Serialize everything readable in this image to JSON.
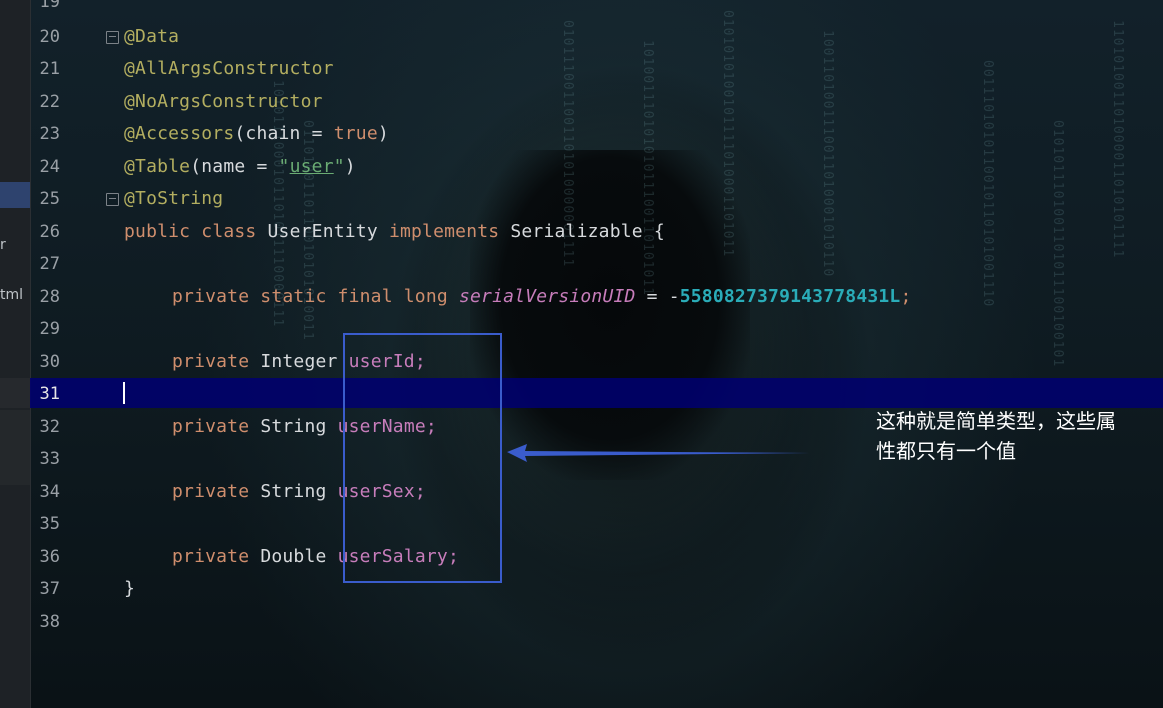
{
  "sidebar": {
    "fragments": [
      "r",
      "tml"
    ]
  },
  "gutter": {
    "lines": [
      "19",
      "20",
      "21",
      "22",
      "23",
      "24",
      "25",
      "26",
      "27",
      "28",
      "29",
      "30",
      "31",
      "32",
      "33",
      "34",
      "35",
      "36",
      "37",
      "38"
    ],
    "active_line": "31"
  },
  "code": {
    "line20": "@Data",
    "line21": "@AllArgsConstructor",
    "line22": "@NoArgsConstructor",
    "line23_ann": "@Accessors",
    "line23_args_a": "(chain = ",
    "line23_val": "true",
    "line23_args_b": ")",
    "line24_ann": "@Table",
    "line24_args_a": "(name = ",
    "line24_q1": "\"",
    "line24_str": "user",
    "line24_q2": "\"",
    "line24_args_b": ")",
    "line25": "@ToString",
    "line26_kw1": "public",
    "line26_kw2": "class",
    "line26_name": "UserEntity",
    "line26_kw3": "implements",
    "line26_iface": "Serializable {",
    "line28_kw": "private static final long",
    "line28_field": "serialVersionUID",
    "line28_op": " = -",
    "line28_num": "5580827379143778431L",
    "line28_end": ";",
    "fields": [
      {
        "kw": "private",
        "type": "Integer",
        "name": "userId;"
      },
      {
        "kw": "private",
        "type": "String",
        "name": "userName;"
      },
      {
        "kw": "private",
        "type": "String",
        "name": "userSex;"
      },
      {
        "kw": "private",
        "type": "Double",
        "name": "userSalary;"
      }
    ],
    "line37": "}"
  },
  "annotation": {
    "note_line1": "这种就是简单类型，这些属",
    "note_line2": "性都只有一个值"
  },
  "colors": {
    "annotation": "#b3ae60",
    "keyword": "#cf8e6d",
    "field": "#c77dbb",
    "number": "#2aacb8",
    "highlight_box": "#3a5ccc",
    "caret_line": "#00006e"
  }
}
